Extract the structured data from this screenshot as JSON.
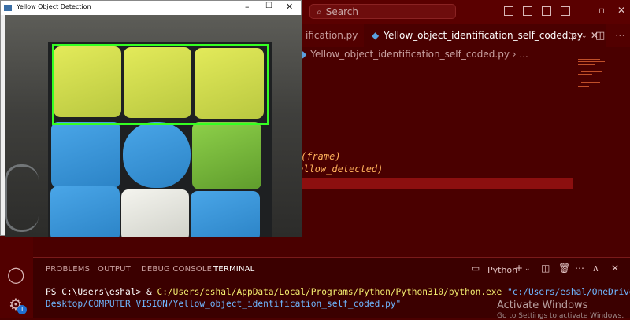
{
  "vscode": {
    "search_placeholder": "Search",
    "tabs": [
      {
        "label": "ification.py",
        "active": false
      },
      {
        "label": "Yellow_object_identification_self_coded.py",
        "active": true
      }
    ],
    "tab_close_glyph": "✕",
    "breadcrumb": [
      "Yellow_object_identification_self_coded.py",
      "..."
    ],
    "code_lines": [
      {
        "text": "(frame)"
      },
      {
        "text": "ellow_detected)"
      }
    ],
    "panel": {
      "tabs": [
        "PROBLEMS",
        "OUTPUT",
        "DEBUG CONSOLE",
        "TERMINAL"
      ],
      "active_tab": "TERMINAL",
      "shell_label": "Python"
    },
    "terminal": {
      "prompt": "PS C:\\Users\\eshal> & ",
      "exe_path": "C:/Users/eshal/AppData/Local/Programs/Python/Python310/python.exe",
      "arg_part1": " \"c:/Users/eshal/OneDrive/",
      "arg_part2": "Desktop/COMPUTER VISION/Yellow_object_identification_self_coded.py\""
    },
    "watermark": {
      "line1": "Activate Windows",
      "line2": "Go to Settings to activate Windows."
    },
    "accounts_badge": "1"
  },
  "cv_window": {
    "title": "Yellow Object Detection",
    "controls": [
      "–",
      "☐",
      "✕"
    ]
  },
  "colors": {
    "theme_bg": "#4a0000",
    "detection_box": "#35ff22",
    "cube_yellow": "#d6e04e",
    "cube_blue": "#3a96da",
    "cube_green": "#7cbf3d"
  },
  "icons": [
    "search-icon",
    "python-file-icon",
    "run-icon",
    "split-editor-icon",
    "more-icon",
    "account-icon",
    "settings-gear-icon",
    "add-terminal-icon",
    "trash-icon",
    "maximize-panel-icon",
    "close-panel-icon"
  ]
}
